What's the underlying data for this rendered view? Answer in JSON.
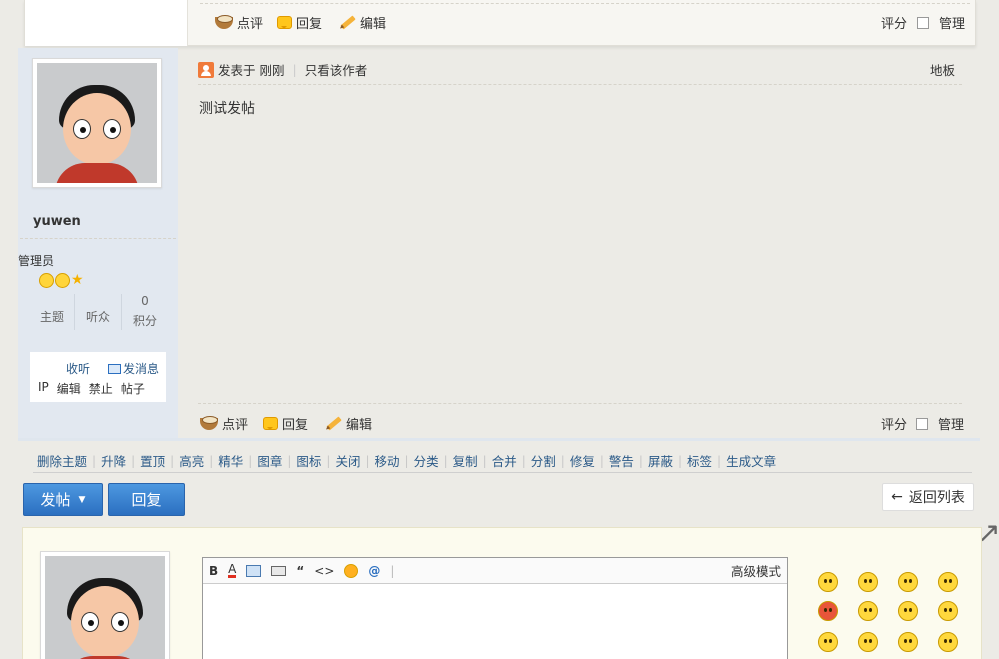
{
  "prev_post": {
    "actions": [
      "点评",
      "回复",
      "编辑"
    ],
    "rate_label": "评分",
    "manage_label": "管理"
  },
  "post": {
    "meta_prefix": "发表于",
    "time": "刚刚",
    "only_author": "只看该作者",
    "floor": "地板",
    "body": "测试发帖",
    "actions": [
      "点评",
      "回复",
      "编辑"
    ],
    "rate_label": "评分",
    "manage_label": "管理"
  },
  "author": {
    "username": "yuwen",
    "group": "管理员",
    "stats": [
      {
        "value": "",
        "label": "主题"
      },
      {
        "value": "",
        "label": "听众"
      },
      {
        "value": "0",
        "label": "积分"
      }
    ],
    "follow": "收听",
    "message": "发消息",
    "admin_links": [
      "IP",
      "编辑",
      "禁止",
      "帖子"
    ]
  },
  "mod_tools": [
    "删除主题",
    "升降",
    "置顶",
    "高亮",
    "精华",
    "图章",
    "图标",
    "关闭",
    "移动",
    "分类",
    "复制",
    "合并",
    "分割",
    "修复",
    "警告",
    "屏蔽",
    "标签",
    "生成文章"
  ],
  "buttons": {
    "new_post": "发帖",
    "reply": "回复",
    "back_to_list": "返回列表"
  },
  "editor": {
    "tools": [
      "B",
      "A",
      "@"
    ],
    "quote": "“",
    "code": "<>",
    "advanced_mode": "高级模式"
  }
}
